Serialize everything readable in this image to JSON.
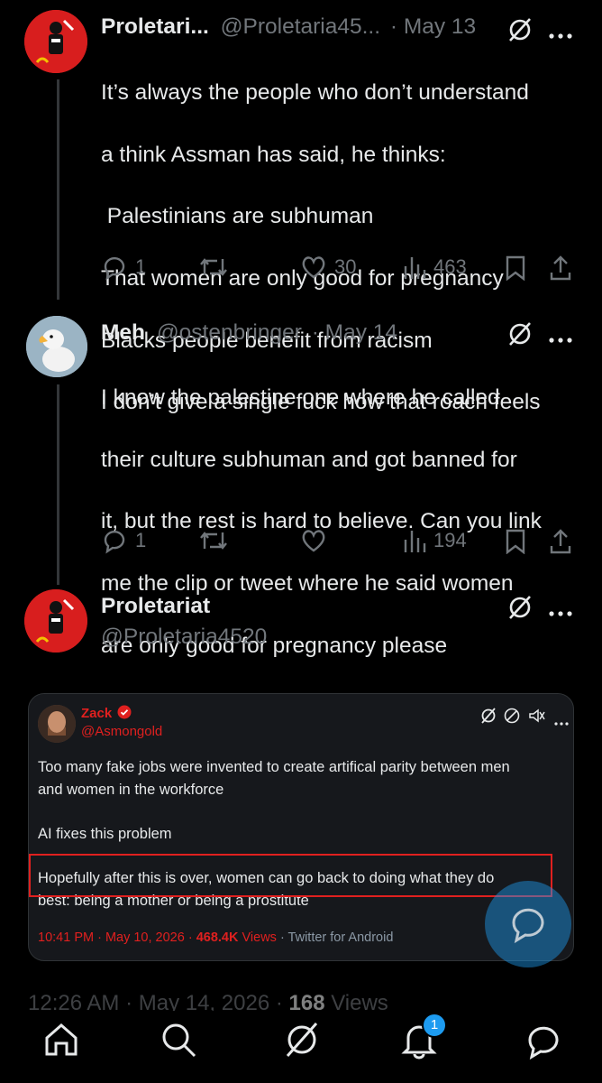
{
  "tweet1": {
    "display_name": "Proletari...",
    "handle": "@Proletaria45...",
    "date": "· May 13",
    "lines": [
      "It’s always the people who don’t understand",
      "a think Assman has said, he thinks:",
      " Palestinians are subhuman",
      "That women are only good for pregnancy",
      "Blacks people benefit from racism",
      "I don’t give a single fuck how that roach feels"
    ],
    "replies": "1",
    "likes": "30",
    "views": "463"
  },
  "tweet2": {
    "display_name": "Meh",
    "handle": "@ostenbringer",
    "date": "· May 14",
    "lines": [
      "I know the palestine one where he called",
      "their culture subhuman and got banned for",
      "it, but the rest is hard to believe. Can you link",
      "me the clip or tweet where he said women",
      "are only good for pregnancy please"
    ],
    "replies": "1",
    "views": "194"
  },
  "tweet3": {
    "display_name": "Proletariat",
    "handle": "@Proletaria4520"
  },
  "quote": {
    "display_name": "Zack",
    "handle": "@Asmongold",
    "line1": "Too many fake jobs were invented to create artifical parity between men",
    "line2": "and women in the workforce",
    "line3": "AI fixes this problem",
    "line4": "Hopefully after this is over, women can go back to doing what they do",
    "line5": "best: being a mother or being a prostitute",
    "time_date": "10:41 PM · May 10, 2026 ·",
    "views_count": "468.4K",
    "views_label": "Views",
    "client": "· Twitter for Android"
  },
  "footer": {
    "timestamp": "12:26 AM · May 14, 2026 ·",
    "views_count": "168",
    "views_label": "Views"
  },
  "nav": {
    "notification_count": "1"
  },
  "colors": {
    "background": "#000000",
    "text": "#e7e9ea",
    "muted": "#71767b",
    "accent": "#1d9bf0",
    "highlight": "#e0201f"
  }
}
